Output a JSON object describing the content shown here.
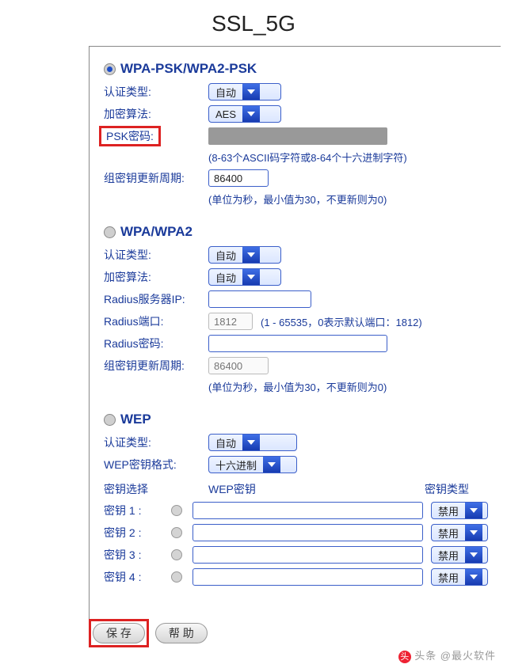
{
  "title": "SSL_5G",
  "labels": {
    "auth": "认证类型:",
    "algo": "加密算法:",
    "psk": "PSK密码:",
    "rekey": "组密钥更新周期:",
    "radiusIp": "Radius服务器IP:",
    "radiusPort": "Radius端口:",
    "radiusPwd": "Radius密码:",
    "wepFmt": "WEP密钥格式:",
    "keySelect": "密钥选择",
    "wepKey": "WEP密钥",
    "keyType": "密钥类型",
    "key": "密钥"
  },
  "hints": {
    "pskRule": "(8-63个ASCII码字符或8-64个十六进制字符)",
    "rekeyRule": "(单位为秒，最小值为30，不更新则为0)",
    "portRule": "(1 - 65535，0表示默认端口：1812)"
  },
  "values": {
    "auto": "自动",
    "aes": "AES",
    "hex": "十六进制",
    "disable": "禁用",
    "rekey": "86400",
    "portPh": "1812"
  },
  "sections": {
    "wpapsk": "WPA-PSK/WPA2-PSK",
    "wpa": "WPA/WPA2",
    "wep": "WEP"
  },
  "buttons": {
    "save": "保 存",
    "help": "帮 助"
  },
  "credit": "头条 @最火软件"
}
